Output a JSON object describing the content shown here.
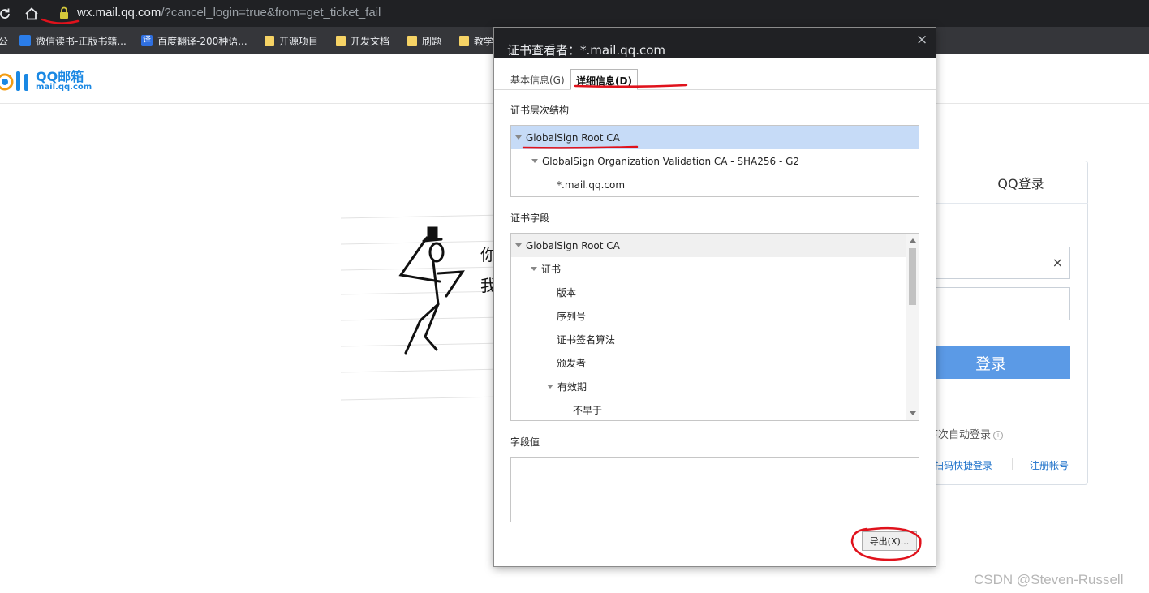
{
  "browser": {
    "url_host": "wx.mail.qq.com",
    "url_rest": "/?cancel_login=true&from=get_ticket_fail",
    "bookmarks": [
      {
        "label": "公"
      },
      {
        "label": "微信读书-正版书籍..."
      },
      {
        "label": "百度翻译-200种语..."
      },
      {
        "label": "开源项目"
      },
      {
        "label": "开发文档"
      },
      {
        "label": "刷题"
      },
      {
        "label": "教学"
      }
    ],
    "translate_icon_glyph": "译"
  },
  "page": {
    "logo_main": "QQ邮箱",
    "logo_sub": "mail.qq.com",
    "illustration_text_1": "你",
    "illustration_text_2": "我",
    "login": {
      "tab_label": "QQ登录",
      "clear_glyph": "×",
      "button_label": "登录",
      "auto_login_label": "下次自动登录",
      "help_glyph": "i",
      "quick_login_label": "扫码快捷登录",
      "register_label": "注册帐号"
    },
    "watermark": "CSDN @Steven-Russell"
  },
  "dialog": {
    "title": "证书查看者：*.mail.qq.com",
    "close_glyph": "×",
    "tabs": [
      {
        "label": "基本信息(G)"
      },
      {
        "label": "详细信息(D)"
      }
    ],
    "hierarchy_label": "证书层次结构",
    "hierarchy": [
      {
        "label": "GlobalSign Root CA"
      },
      {
        "label": "GlobalSign Organization Validation CA - SHA256 - G2"
      },
      {
        "label": "*.mail.qq.com"
      }
    ],
    "fields_label": "证书字段",
    "fields": [
      {
        "label": "GlobalSign Root CA"
      },
      {
        "label": "证书"
      },
      {
        "label": "版本"
      },
      {
        "label": "序列号"
      },
      {
        "label": "证书签名算法"
      },
      {
        "label": "颁发者"
      },
      {
        "label": "有效期"
      },
      {
        "label": "不早于"
      }
    ],
    "value_label": "字段值",
    "export_label": "导出(X)..."
  },
  "colors": {
    "chrome_dark": "#202124",
    "bookmark_bar": "#35363a",
    "brand_blue": "#1a88e3",
    "login_button": "#5b9ae6",
    "selection": "#c6dbf7",
    "annotation_red": "#e0121c"
  }
}
